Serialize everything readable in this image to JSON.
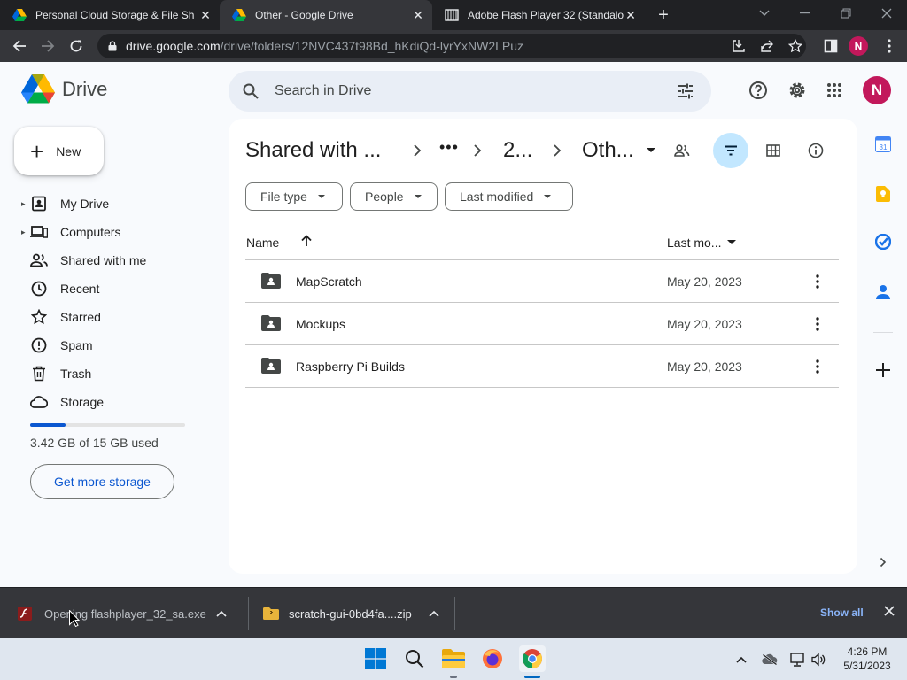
{
  "browser": {
    "tabs": [
      {
        "title": "Personal Cloud Storage & File Sh",
        "icon": "google-drive-icon",
        "active": false
      },
      {
        "title": "Other - Google Drive",
        "icon": "google-drive-icon",
        "active": true
      },
      {
        "title": "Adobe Flash Player 32 (Standalon",
        "icon": "archive-icon",
        "active": false
      }
    ],
    "url_host": "drive.google.com",
    "url_path": "/drive/folders/12NVC437t98Bd_hKdiQd-lyrYxNW2LPuz",
    "profile_initial": "N"
  },
  "drive": {
    "logo_text": "Drive",
    "search_placeholder": "Search in Drive",
    "avatar_initial": "N",
    "new_label": "New",
    "nav": [
      {
        "label": "My Drive",
        "icon": "my-drive-icon",
        "expandable": true
      },
      {
        "label": "Computers",
        "icon": "computers-icon",
        "expandable": true
      },
      {
        "label": "Shared with me",
        "icon": "shared-icon",
        "expandable": false
      },
      {
        "label": "Recent",
        "icon": "clock-icon",
        "expandable": false
      },
      {
        "label": "Starred",
        "icon": "star-icon",
        "expandable": false
      },
      {
        "label": "Spam",
        "icon": "spam-icon",
        "expandable": false
      },
      {
        "label": "Trash",
        "icon": "trash-icon",
        "expandable": false
      },
      {
        "label": "Storage",
        "icon": "cloud-icon",
        "expandable": false
      }
    ],
    "storage_used_fraction": 0.228,
    "storage_text": "3.42 GB of 15 GB used",
    "get_more_storage": "Get more storage",
    "breadcrumb": {
      "root": "Shared with ...",
      "ellipsis": "•••",
      "middle": "2...",
      "current": "Oth..."
    },
    "filters": {
      "file_type": "File type",
      "people": "People",
      "last_modified": "Last modified"
    },
    "table": {
      "col_name": "Name",
      "col_modified": "Last mo...",
      "rows": [
        {
          "name": "MapScratch",
          "modified": "May 20, 2023"
        },
        {
          "name": "Mockups",
          "modified": "May 20, 2023"
        },
        {
          "name": "Raspberry Pi Builds",
          "modified": "May 20, 2023"
        }
      ]
    },
    "colors": {
      "accent": "#0b57d0",
      "avatar": "#c2185b",
      "filter_active_bg": "#c2e7ff"
    }
  },
  "downloads": {
    "items": [
      {
        "label": "Opening flashplayer_32_sa.exe...",
        "icon": "flash-icon"
      },
      {
        "label": "scratch-gui-0bd4fa....zip",
        "icon": "zip-folder-icon"
      }
    ],
    "show_all": "Show all"
  },
  "taskbar": {
    "time": "4:26 PM",
    "date": "5/31/2023"
  }
}
